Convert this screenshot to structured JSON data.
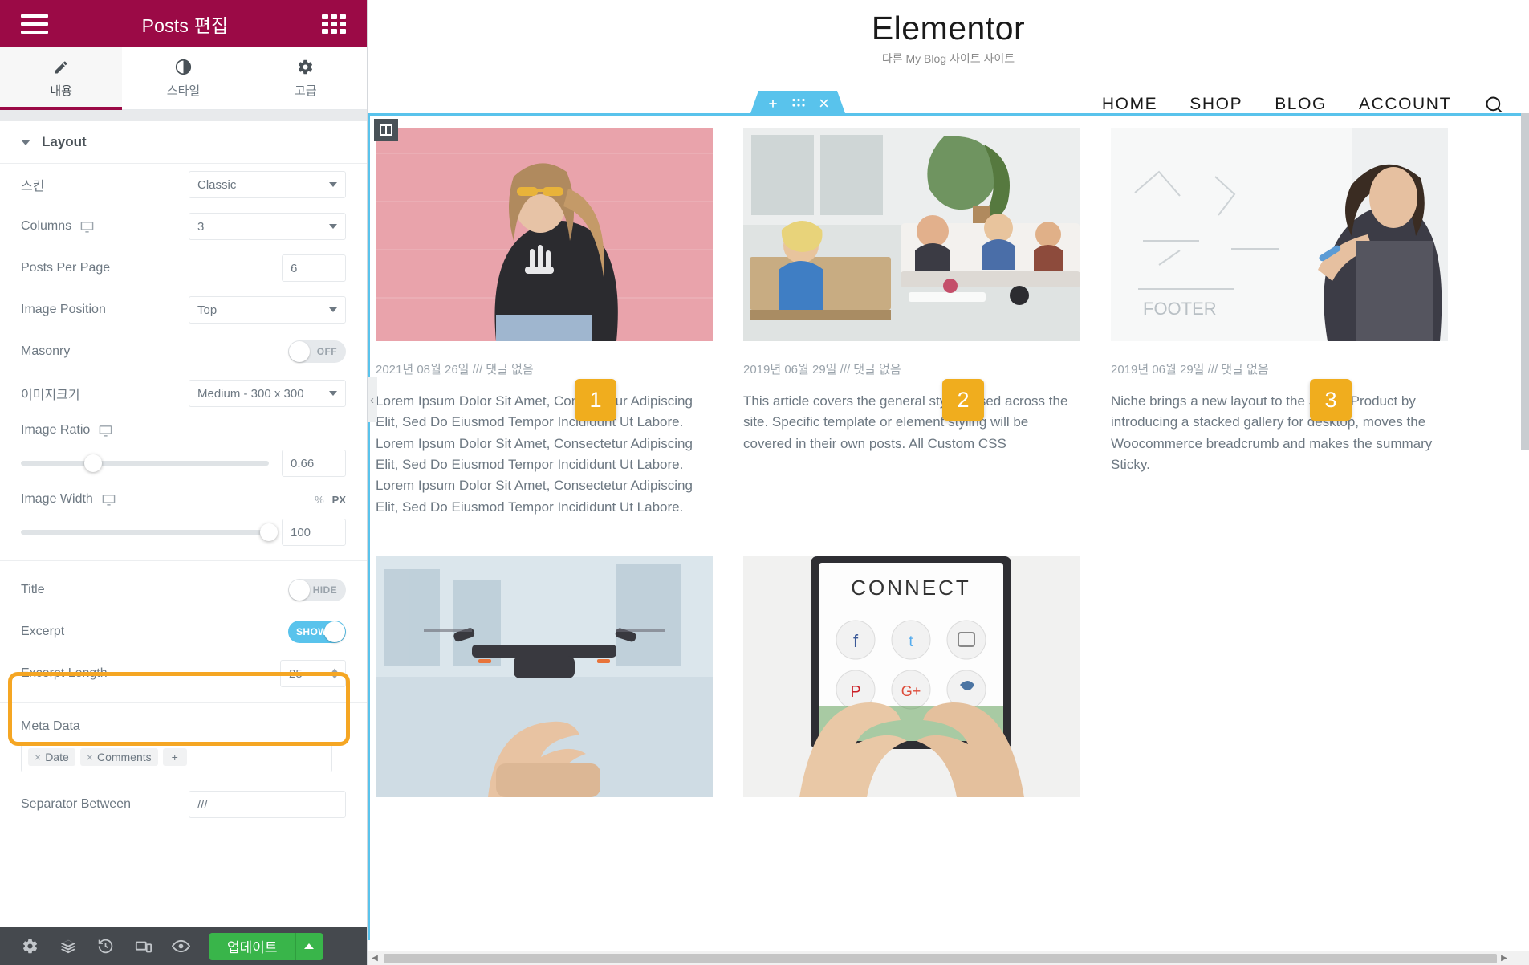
{
  "panel": {
    "title": "Posts 편집",
    "menu_icon": "hamburger-icon",
    "widgets_icon": "grid-icon",
    "tabs": [
      {
        "label": "내용",
        "icon": "pencil-icon",
        "active": true
      },
      {
        "label": "스타일",
        "icon": "contrast-icon",
        "active": false
      },
      {
        "label": "고급",
        "icon": "gear-icon",
        "active": false
      }
    ],
    "section": {
      "title": "Layout",
      "expanded": true
    },
    "controls": {
      "skin": {
        "label": "스킨",
        "value": "Classic"
      },
      "columns": {
        "label": "Columns",
        "value": "3",
        "device": "desktop"
      },
      "posts_per_page": {
        "label": "Posts Per Page",
        "value": "6"
      },
      "image_position": {
        "label": "Image Position",
        "value": "Top"
      },
      "masonry": {
        "label": "Masonry",
        "state": "OFF",
        "on": false
      },
      "image_size": {
        "label": "이미지크기",
        "value": "Medium - 300 x 300"
      },
      "image_ratio": {
        "label": "Image Ratio",
        "value": "0.66",
        "device": "desktop",
        "slider_pct": 29
      },
      "image_width": {
        "label": "Image Width",
        "value": "100",
        "device": "desktop",
        "units": [
          "%",
          "PX"
        ],
        "active_unit": "PX",
        "slider_pct": 100
      },
      "title": {
        "label": "Title",
        "state": "HIDE",
        "on": false
      },
      "excerpt": {
        "label": "Excerpt",
        "state": "SHOW",
        "on": true
      },
      "excerpt_length": {
        "label": "Excerpt Length",
        "value": "25"
      },
      "meta_data": {
        "label": "Meta Data",
        "tags": [
          "Date",
          "Comments"
        ],
        "add_label": "+"
      },
      "separator_between": {
        "label": "Separator Between",
        "value": "///"
      }
    },
    "footer": {
      "icons": [
        "gear-icon",
        "layers-icon",
        "history-icon",
        "responsive-icon",
        "preview-icon"
      ],
      "update_label": "업데이트",
      "update_caret": "chevron-up-icon"
    }
  },
  "preview": {
    "brand": {
      "title": "Elementor",
      "tagline": "다른 My Blog 사이트 사이트"
    },
    "nav": [
      "HOME",
      "SHOP",
      "BLOG",
      "ACCOUNT"
    ],
    "search_icon": "search-icon",
    "widget_toolbar": {
      "add": "plus-icon",
      "drag": "dots-grid-icon",
      "remove": "close-icon"
    },
    "column_handle_icon": "columns-icon",
    "posts": [
      {
        "badge": "1",
        "meta": "2021년 08월 26일 /// 댓글 없음",
        "excerpt": "Lorem Ipsum Dolor Sit Amet, Consectetur Adipiscing Elit, Sed Do Eiusmod Tempor Incididunt Ut Labore. Lorem Ipsum Dolor Sit Amet, Consectetur Adipiscing Elit, Sed Do Eiusmod Tempor Incididunt Ut Labore. Lorem Ipsum Dolor Sit Amet, Consectetur Adipiscing Elit, Sed Do Eiusmod Tempor Incididunt Ut Labore.",
        "image": "woman-pink-wall"
      },
      {
        "badge": "2",
        "meta": "2019년 06월 29일 /// 댓글 없음",
        "excerpt": "This article covers the general styling used across the site. Specific template or element styling will be covered in their own posts. All Custom CSS",
        "image": "office-meeting"
      },
      {
        "badge": "3",
        "meta": "2019년 06월 29일 /// 댓글 없음",
        "excerpt": "Niche brings a new layout to the Single Product by introducing a stacked gallery for desktop, moves the Woocommerce breadcrumb and makes the summary Sticky.",
        "image": "woman-whiteboard"
      },
      {
        "badge": "",
        "meta": "",
        "excerpt": "",
        "image": "drone-hand"
      },
      {
        "badge": "",
        "meta": "",
        "excerpt": "",
        "image": "tablet-connect"
      }
    ]
  },
  "colors": {
    "brand_magenta": "#9b0a46",
    "accent_blue": "#59c3ec",
    "badge_orange": "#f0ad1e",
    "highlight_orange": "#f5a623",
    "update_green": "#39b54a",
    "footer_dark": "#45494e"
  }
}
